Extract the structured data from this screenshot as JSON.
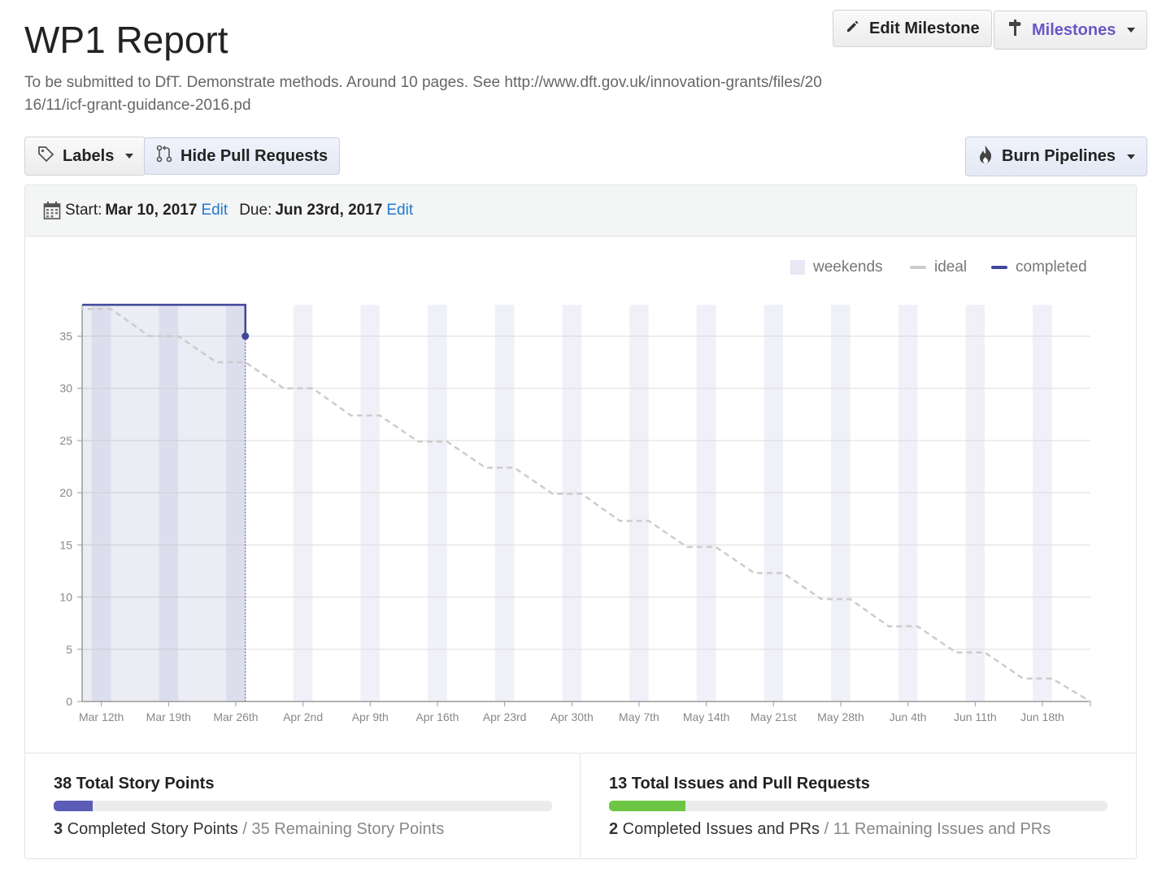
{
  "milestone": {
    "title": "WP1 Report",
    "description": "To be submitted to DfT. Demonstrate methods. Around 10 pages. See http://www.dft.gov.uk/innovation-grants/files/2016/11/icf-grant-guidance-2016.pd"
  },
  "toolbar": {
    "edit_milestone": "Edit Milestone",
    "milestones": "Milestones",
    "labels": "Labels",
    "hide_prs": "Hide Pull Requests",
    "burn_pipelines": "Burn Pipelines"
  },
  "dates": {
    "start_label": "Start:",
    "start_value": "Mar 10, 2017",
    "start_edit": "Edit",
    "due_label": "Due:",
    "due_value": "Jun 23rd, 2017",
    "due_edit": "Edit"
  },
  "legend": {
    "weekends": "weekends",
    "ideal": "ideal",
    "completed": "completed"
  },
  "colors": {
    "completed": "#3f4797",
    "ideal": "#cccccc",
    "weekend": "#f0f0f8",
    "story_bar": "#5b5bb8",
    "issues_bar": "#6cc644"
  },
  "chart_data": {
    "type": "line",
    "x_start": "2017-03-10",
    "x_end": "2017-06-23",
    "x_tick_labels": [
      "Mar 12th",
      "Mar 19th",
      "Mar 26th",
      "Apr 2nd",
      "Apr 9th",
      "Apr 16th",
      "Apr 23rd",
      "Apr 30th",
      "May 7th",
      "May 14th",
      "May 21st",
      "May 28th",
      "Jun 4th",
      "Jun 11th",
      "Jun 18th"
    ],
    "y_ticks": [
      0,
      5,
      10,
      15,
      20,
      25,
      30,
      35
    ],
    "ylim": [
      0,
      38
    ],
    "series": [
      {
        "name": "ideal",
        "style": "dashed",
        "points": [
          {
            "x": "2017-03-10",
            "y": 38
          },
          {
            "x": "2017-03-10",
            "y": 37.6
          },
          {
            "x": "2017-03-13",
            "y": 37.6
          },
          {
            "x": "2017-03-17",
            "y": 35.0
          },
          {
            "x": "2017-03-20",
            "y": 35.0
          },
          {
            "x": "2017-03-24",
            "y": 32.5
          },
          {
            "x": "2017-03-27",
            "y": 32.5
          },
          {
            "x": "2017-03-31",
            "y": 30.0
          },
          {
            "x": "2017-04-03",
            "y": 30.0
          },
          {
            "x": "2017-04-07",
            "y": 27.4
          },
          {
            "x": "2017-04-10",
            "y": 27.4
          },
          {
            "x": "2017-04-14",
            "y": 24.9
          },
          {
            "x": "2017-04-17",
            "y": 24.9
          },
          {
            "x": "2017-04-21",
            "y": 22.4
          },
          {
            "x": "2017-04-24",
            "y": 22.4
          },
          {
            "x": "2017-04-28",
            "y": 19.9
          },
          {
            "x": "2017-05-01",
            "y": 19.9
          },
          {
            "x": "2017-05-05",
            "y": 17.3
          },
          {
            "x": "2017-05-08",
            "y": 17.3
          },
          {
            "x": "2017-05-12",
            "y": 14.8
          },
          {
            "x": "2017-05-15",
            "y": 14.8
          },
          {
            "x": "2017-05-19",
            "y": 12.3
          },
          {
            "x": "2017-05-22",
            "y": 12.3
          },
          {
            "x": "2017-05-26",
            "y": 9.8
          },
          {
            "x": "2017-05-29",
            "y": 9.8
          },
          {
            "x": "2017-06-02",
            "y": 7.2
          },
          {
            "x": "2017-06-05",
            "y": 7.2
          },
          {
            "x": "2017-06-09",
            "y": 4.7
          },
          {
            "x": "2017-06-12",
            "y": 4.7
          },
          {
            "x": "2017-06-16",
            "y": 2.2
          },
          {
            "x": "2017-06-19",
            "y": 2.2
          },
          {
            "x": "2017-06-23",
            "y": 0
          }
        ]
      },
      {
        "name": "completed",
        "style": "step",
        "points": [
          {
            "x": "2017-03-10",
            "y": 38
          },
          {
            "x": "2017-03-27",
            "y": 38
          },
          {
            "x": "2017-03-27",
            "y": 35
          }
        ]
      }
    ],
    "grid": true,
    "legend_position": "top-right"
  },
  "stats": {
    "story": {
      "title": "38 Total Story Points",
      "completed_num": "3",
      "completed_text": " Completed Story Points",
      "sep": " / ",
      "remaining_text": "35 Remaining Story Points",
      "fraction": 0.079
    },
    "issues": {
      "title": "13 Total Issues and Pull Requests",
      "completed_num": "2",
      "completed_text": " Completed Issues and PRs",
      "sep": " / ",
      "remaining_text": "11 Remaining Issues and PRs",
      "fraction": 0.154
    }
  }
}
